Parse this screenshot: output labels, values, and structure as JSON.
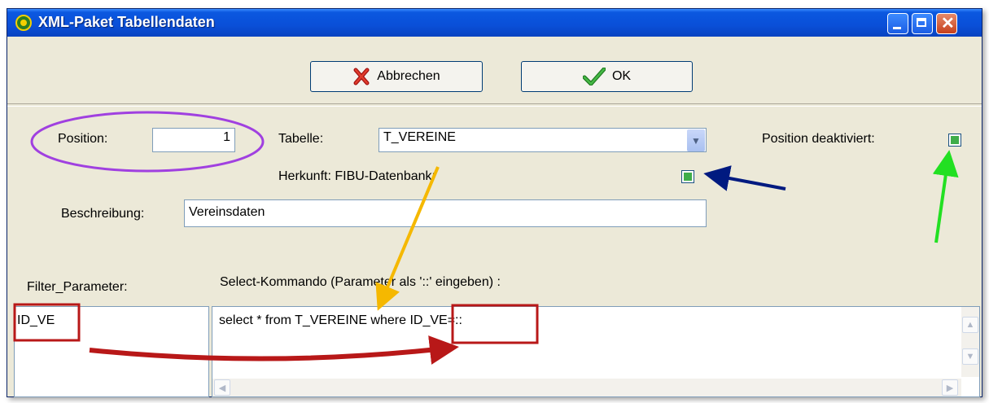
{
  "window": {
    "title": "XML-Paket Tabellendaten"
  },
  "toolbar": {
    "cancel_label": "Abbrechen",
    "ok_label": "OK"
  },
  "form": {
    "position_label": "Position:",
    "position_value": "1",
    "table_label": "Tabelle:",
    "table_value": "T_VEREINE",
    "origin_label": "Herkunft: FIBU-Datenbank:",
    "origin_checked": true,
    "deactivated_label": "Position deaktiviert:",
    "deactivated_checked": true,
    "description_label": "Beschreibung:",
    "description_value": "Vereinsdaten",
    "filter_label": "Filter_Parameter:",
    "select_label": "Select-Kommando (Parameter als '::' eingeben) :",
    "filter_value": "ID_VE",
    "select_value": "select * from T_VEREINE where ID_VE=::"
  },
  "annotation_colors": {
    "ellipse": "#a040e0",
    "yellow_arrow": "#f5b800",
    "blue_arrow": "#001a80",
    "green_arrow": "#22e022",
    "red_arrow": "#b81818",
    "red_box": "#b81818"
  }
}
